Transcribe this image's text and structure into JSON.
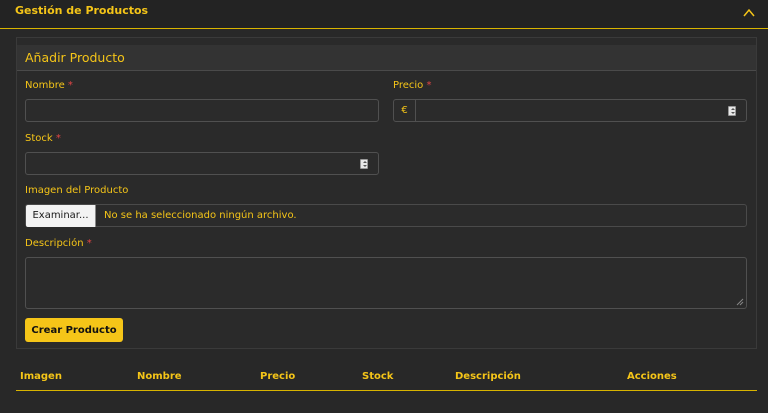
{
  "header": {
    "title": "Gestión de Productos"
  },
  "form": {
    "title": "Añadir Producto",
    "nombre_label": "Nombre",
    "precio_label": "Precio",
    "currency_symbol": "€",
    "stock_label": "Stock",
    "imagen_label": "Imagen del Producto",
    "file_button": "Examinar...",
    "file_status": "No se ha seleccionado ningún archivo.",
    "descripcion_label": "Descripción",
    "required_mark": "*",
    "submit_label": "Crear Producto"
  },
  "table": {
    "columns": [
      "Imagen",
      "Nombre",
      "Precio",
      "Stock",
      "Descripción",
      "Acciones"
    ]
  },
  "colors": {
    "accent": "#f5c518",
    "required": "#e04545",
    "background": "#282828"
  }
}
